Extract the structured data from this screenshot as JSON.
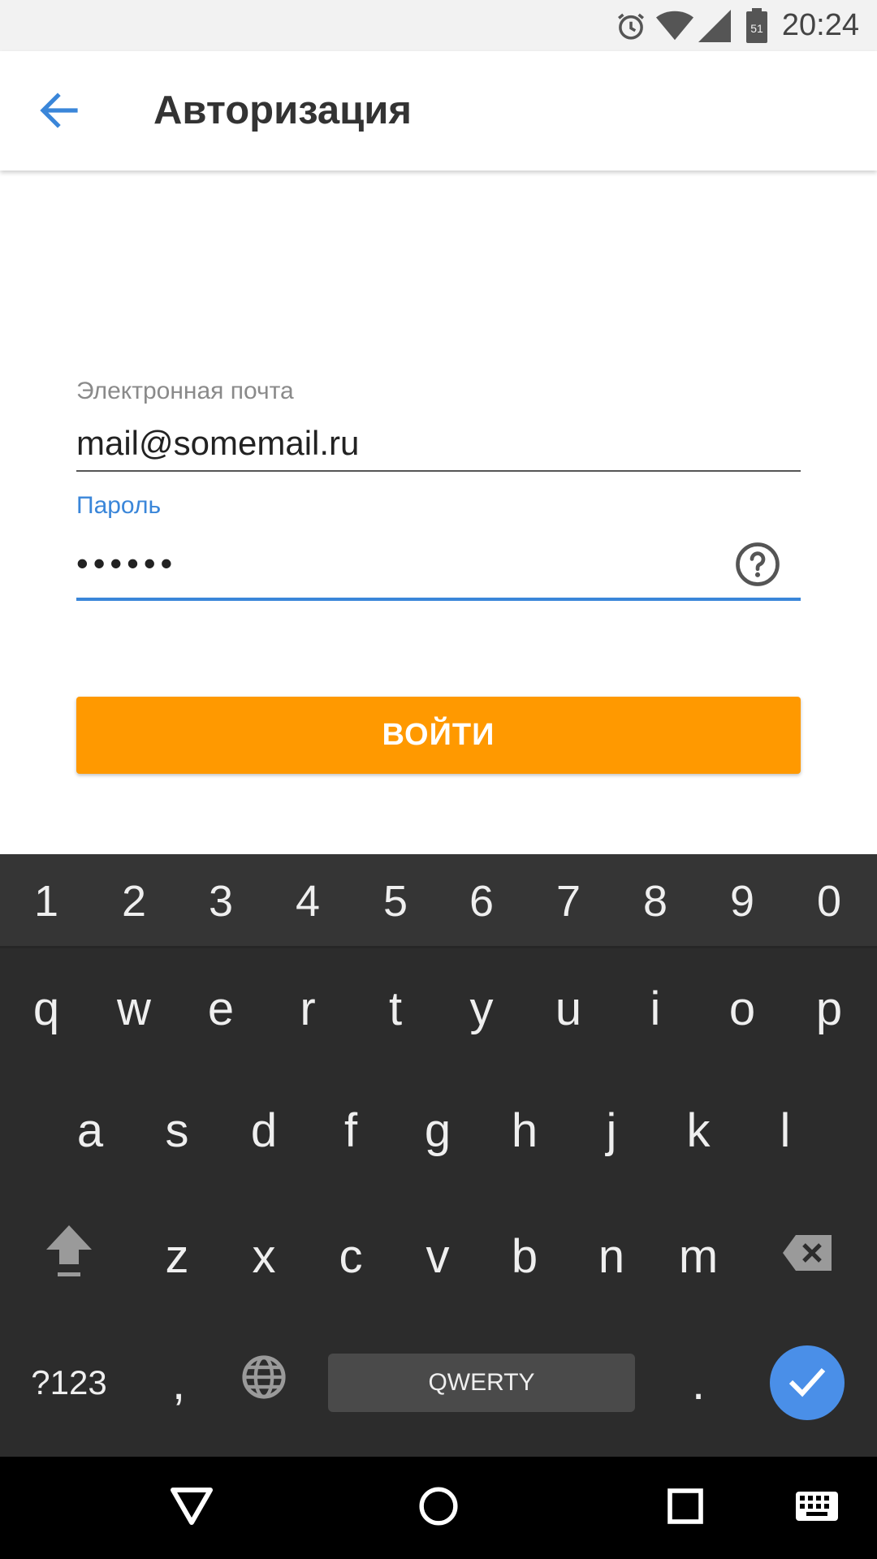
{
  "status_bar": {
    "time": "20:24",
    "battery_level": "51",
    "icons": [
      "alarm-icon",
      "wifi-icon",
      "signal-icon",
      "battery-icon"
    ]
  },
  "app_bar": {
    "title": "Авторизация",
    "back_icon": "arrow-back-icon"
  },
  "form": {
    "email": {
      "label": "Электронная почта",
      "value": "mail@somemail.ru"
    },
    "password": {
      "label": "Пароль",
      "value": "••••••",
      "help_icon": "help-circle-icon"
    },
    "submit_label": "ВОЙТИ"
  },
  "keyboard": {
    "number_row": [
      "1",
      "2",
      "3",
      "4",
      "5",
      "6",
      "7",
      "8",
      "9",
      "0"
    ],
    "row1": [
      "q",
      "w",
      "e",
      "r",
      "t",
      "y",
      "u",
      "i",
      "o",
      "p"
    ],
    "row2": [
      "a",
      "s",
      "d",
      "f",
      "g",
      "h",
      "j",
      "k",
      "l"
    ],
    "row3": [
      "z",
      "x",
      "c",
      "v",
      "b",
      "n",
      "m"
    ],
    "symbols_label": "?123",
    "comma_label": ",",
    "space_label": "QWERTY",
    "period_label": ".",
    "shift_icon": "shift-icon",
    "backspace_icon": "backspace-icon",
    "globe_icon": "globe-icon",
    "enter_icon": "check-icon"
  },
  "nav_bar": {
    "icons": [
      "back-triangle-icon",
      "home-circle-icon",
      "recents-square-icon",
      "keyboard-icon"
    ]
  },
  "colors": {
    "accent_blue": "#3a86d9",
    "button_orange": "#ff9900",
    "keyboard_bg": "#2c2c2c",
    "enter_blue": "#4a8fe8"
  }
}
